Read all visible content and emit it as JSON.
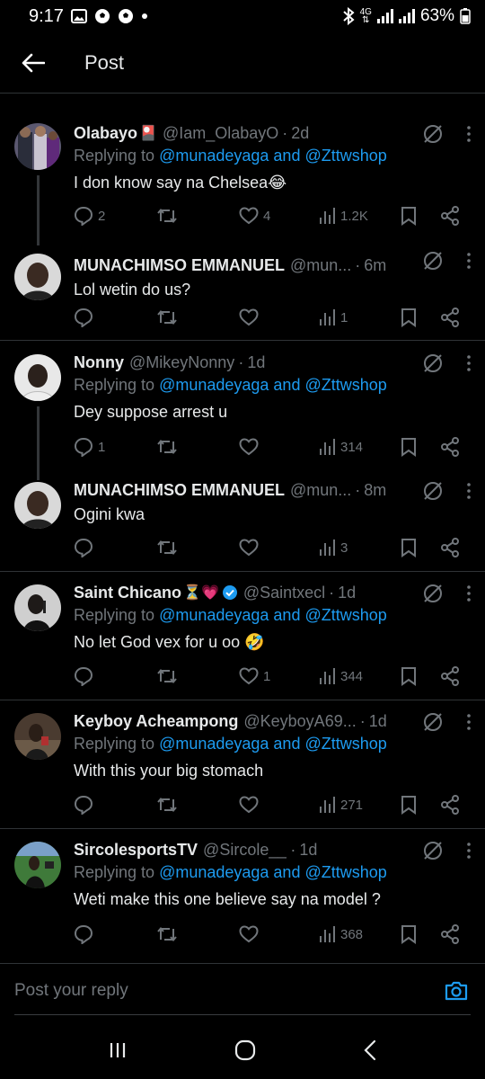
{
  "status_bar": {
    "time": "9:17",
    "battery": "63%",
    "network": "4G"
  },
  "header": {
    "title": "Post"
  },
  "tweets": [
    {
      "name": "Olabayo",
      "name_emoji": "🎴",
      "handle": "@Iam_OlabayO",
      "time": "2d",
      "replying_prefix": "Replying to ",
      "replying_mentions": "@munadeyaga and @Zttwshop",
      "text": "I don know say na Chelsea😂",
      "replies": "2",
      "retweets": "",
      "likes": "4",
      "views": "1.2K"
    },
    {
      "name": "MUNACHIMSO EMMANUEL",
      "handle": "@mun...",
      "time": "6m",
      "text": "Lol wetin do us?",
      "replies": "",
      "retweets": "",
      "likes": "",
      "views": "1"
    },
    {
      "name": "Nonny",
      "handle": "@MikeyNonny",
      "time": "1d",
      "replying_prefix": "Replying to ",
      "replying_mentions": "@munadeyaga and @Zttwshop",
      "text": "Dey suppose arrest u",
      "replies": "1",
      "retweets": "",
      "likes": "",
      "views": "314"
    },
    {
      "name": "MUNACHIMSO EMMANUEL",
      "handle": "@mun...",
      "time": "8m",
      "text": "Ogini kwa",
      "replies": "",
      "retweets": "",
      "likes": "",
      "views": "3"
    },
    {
      "name": "Saint Chicano",
      "name_emoji": "⏳💗",
      "handle": "@Saintxecl",
      "time": "1d",
      "replying_prefix": "Replying to ",
      "replying_mentions": "@munadeyaga and @Zttwshop",
      "text": "No let God vex for u oo 🤣",
      "replies": "",
      "retweets": "",
      "likes": "1",
      "views": "344"
    },
    {
      "name": "Keyboy Acheampong",
      "handle": "@KeyboyA69...",
      "time": "1d",
      "replying_prefix": "Replying to ",
      "replying_mentions": "@munadeyaga and @Zttwshop",
      "text": "With this your big stomach",
      "replies": "",
      "retweets": "",
      "likes": "",
      "views": "271"
    },
    {
      "name": "SircolesportsTV",
      "handle": "@Sircole__",
      "time": "1d",
      "replying_prefix": "Replying to ",
      "replying_mentions": "@munadeyaga and @Zttwshop",
      "text": "Weti make this one believe say na model ?",
      "replies": "",
      "retweets": "",
      "likes": "",
      "views": "368"
    }
  ],
  "reply_bar": {
    "placeholder": "Post your reply"
  },
  "colors": {
    "accent": "#1d9bf0",
    "muted": "#71767b",
    "text": "#e7e9ea",
    "divider": "#2f3336",
    "verified": "#1d9bf0"
  }
}
